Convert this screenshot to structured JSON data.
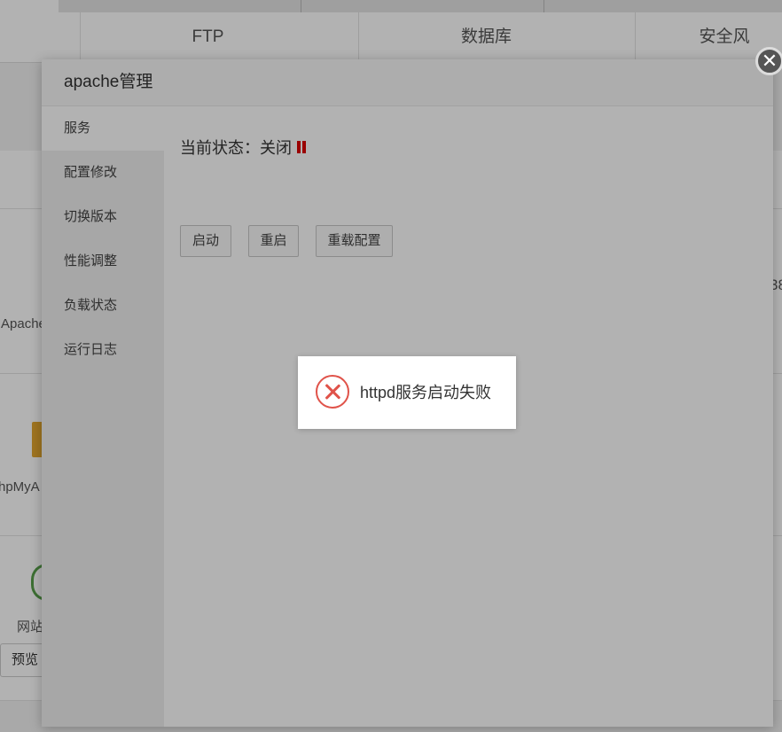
{
  "background": {
    "nav_items": [
      "FTP",
      "数据库",
      "安全风"
    ],
    "left_labels": {
      "apache": "Apache",
      "phpmyadmin": "hpMyA",
      "website": "网站",
      "preview_button": "预览"
    },
    "right_fragment": "38"
  },
  "modal": {
    "title": "apache管理",
    "close_glyph": "✕",
    "sidebar": [
      {
        "label": "服务",
        "active": true
      },
      {
        "label": "配置修改"
      },
      {
        "label": "切换版本"
      },
      {
        "label": "性能调整"
      },
      {
        "label": "负载状态"
      },
      {
        "label": "运行日志"
      }
    ],
    "status_label": "当前状态：关闭",
    "status_color": "#dd0000",
    "buttons": {
      "start": "启动",
      "restart": "重启",
      "reload": "重载配置"
    }
  },
  "toast": {
    "icon": "error-circle-icon",
    "color": "#e0534a",
    "message": "httpd服务启动失败"
  }
}
